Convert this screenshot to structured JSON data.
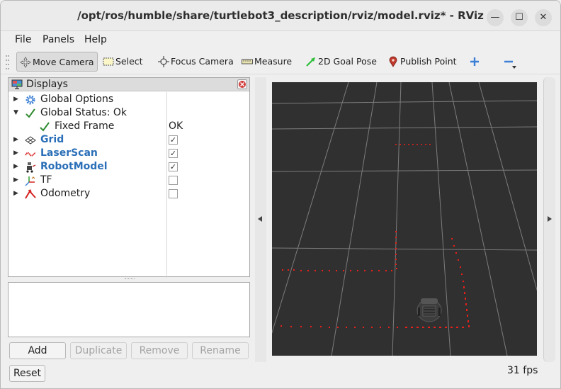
{
  "window": {
    "title": "/opt/ros/humble/share/turtlebot3_description/rviz/model.rviz* - RViz",
    "minimize_glyph": "—",
    "maximize_glyph": "☐",
    "close_glyph": "✕"
  },
  "menubar": {
    "items": [
      "File",
      "Panels",
      "Help"
    ]
  },
  "toolbar": {
    "tools": [
      {
        "label": "Move Camera",
        "icon": "move-camera-icon",
        "active": true
      },
      {
        "label": "Select",
        "icon": "select-icon"
      },
      {
        "label": "Focus Camera",
        "icon": "focus-camera-icon"
      },
      {
        "label": "Measure",
        "icon": "measure-icon"
      },
      {
        "label": "2D Goal Pose",
        "icon": "goal-pose-icon"
      },
      {
        "label": "Publish Point",
        "icon": "publish-point-icon"
      }
    ],
    "add_tool_icon": "plus-icon",
    "remove_tool_icon": "minus-icon"
  },
  "displays_panel": {
    "title": "Displays",
    "items": [
      {
        "label": "Global Options",
        "icon": "gear-icon",
        "expand": "collapsed"
      },
      {
        "label": "Global Status: Ok",
        "icon": "check-icon",
        "expand": "expanded"
      },
      {
        "label": "Fixed Frame",
        "icon": "check-icon",
        "value": "OK",
        "child": true
      },
      {
        "label": "Grid",
        "icon": "grid-icon",
        "checked": true,
        "highlight": true,
        "expand": "collapsed"
      },
      {
        "label": "LaserScan",
        "icon": "laser-scan-icon",
        "checked": true,
        "highlight": true,
        "expand": "collapsed"
      },
      {
        "label": "RobotModel",
        "icon": "robot-model-icon",
        "checked": true,
        "highlight": true,
        "expand": "collapsed"
      },
      {
        "label": "TF",
        "icon": "tf-icon",
        "checked": false,
        "expand": "collapsed"
      },
      {
        "label": "Odometry",
        "icon": "odometry-icon",
        "checked": false,
        "expand": "collapsed"
      }
    ]
  },
  "buttons": {
    "add": "Add",
    "duplicate": "Duplicate",
    "remove": "Remove",
    "rename": "Rename",
    "reset": "Reset"
  },
  "status": {
    "fps": "31 fps"
  },
  "colors": {
    "laser": "#e8201a",
    "viewport_bg": "#303030",
    "grid": "#8a8a8a",
    "highlight_text": "#2a6fb8"
  }
}
